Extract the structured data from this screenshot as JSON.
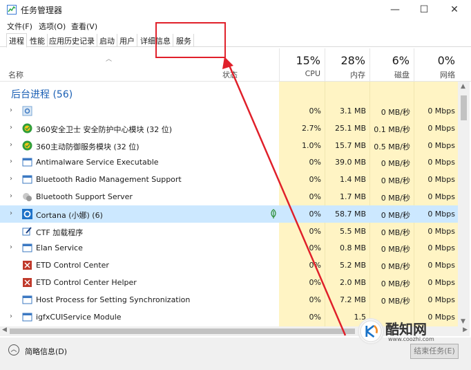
{
  "window": {
    "title": "任务管理器",
    "min_icon": "—",
    "max_icon": "☐",
    "close_icon": "✕"
  },
  "menu": [
    "文件(F)",
    "选项(O)",
    "查看(V)"
  ],
  "tabs": [
    "进程",
    "性能",
    "应用历史记录",
    "启动",
    "用户",
    "详细信息",
    "服务"
  ],
  "active_tab": "进程",
  "header": {
    "name": "名称",
    "status": "状态",
    "columns": [
      {
        "pct": "15%",
        "label": "CPU"
      },
      {
        "pct": "28%",
        "label": "内存"
      },
      {
        "pct": "6%",
        "label": "磁盘"
      },
      {
        "pct": "0%",
        "label": "网络"
      }
    ]
  },
  "group_title": "后台进程 (56)",
  "rows": [
    {
      "name": "",
      "icon": "gear-icon",
      "expandable": true,
      "cpu": "0%",
      "mem": "3.1 MB",
      "disk": "0 MB/秒",
      "net": "0 Mbps"
    },
    {
      "name": "360安全卫士 安全防护中心模块 (32 位)",
      "icon": "360-shield-icon",
      "expandable": true,
      "cpu": "2.7%",
      "mem": "25.1 MB",
      "disk": "0.1 MB/秒",
      "net": "0 Mbps"
    },
    {
      "name": "360主动防御服务模块 (32 位)",
      "icon": "360-shield-icon",
      "expandable": true,
      "cpu": "1.0%",
      "mem": "15.7 MB",
      "disk": "0.5 MB/秒",
      "net": "0 Mbps"
    },
    {
      "name": "Antimalware Service Executable",
      "icon": "window-icon",
      "expandable": true,
      "cpu": "0%",
      "mem": "39.0 MB",
      "disk": "0 MB/秒",
      "net": "0 Mbps"
    },
    {
      "name": "Bluetooth Radio Management Support",
      "icon": "window-icon",
      "expandable": true,
      "cpu": "0%",
      "mem": "1.4 MB",
      "disk": "0 MB/秒",
      "net": "0 Mbps"
    },
    {
      "name": "Bluetooth Support Server",
      "icon": "bluetooth-service-icon",
      "expandable": true,
      "cpu": "0%",
      "mem": "1.7 MB",
      "disk": "0 MB/秒",
      "net": "0 Mbps"
    },
    {
      "name": "Cortana (小娜) (6)",
      "icon": "cortana-icon",
      "expandable": true,
      "selected": true,
      "leaf": true,
      "cpu": "0%",
      "mem": "58.7 MB",
      "disk": "0 MB/秒",
      "net": "0 Mbps"
    },
    {
      "name": "CTF 加载程序",
      "icon": "pen-icon",
      "expandable": false,
      "cpu": "0%",
      "mem": "5.5 MB",
      "disk": "0 MB/秒",
      "net": "0 Mbps"
    },
    {
      "name": "Elan Service",
      "icon": "window-icon",
      "expandable": true,
      "cpu": "0%",
      "mem": "0.8 MB",
      "disk": "0 MB/秒",
      "net": "0 Mbps"
    },
    {
      "name": "ETD Control Center",
      "icon": "etd-icon",
      "expandable": false,
      "cpu": "0%",
      "mem": "5.2 MB",
      "disk": "0 MB/秒",
      "net": "0 Mbps"
    },
    {
      "name": "ETD Control Center Helper",
      "icon": "etd-icon",
      "expandable": false,
      "cpu": "0%",
      "mem": "2.0 MB",
      "disk": "0 MB/秒",
      "net": "0 Mbps"
    },
    {
      "name": "Host Process for Setting Synchronization",
      "icon": "window-icon",
      "expandable": false,
      "cpu": "0%",
      "mem": "7.2 MB",
      "disk": "0 MB/秒",
      "net": "0 Mbps"
    },
    {
      "name": "igfxCUIService Module",
      "icon": "window-icon",
      "expandable": true,
      "cpu": "0%",
      "mem": "1.5",
      "disk": "",
      "net": "0 Mbps"
    }
  ],
  "footer": {
    "less_details": "简略信息(D)",
    "end_task": "结束任务(E)"
  },
  "watermark": {
    "title": "酷知网",
    "sub": "www.coozhi.com"
  },
  "colors": {
    "accent": "#1a5fb4",
    "column_shade": "#fff4c4",
    "selected_row": "#cce8ff",
    "annotation": "#e0202a"
  }
}
